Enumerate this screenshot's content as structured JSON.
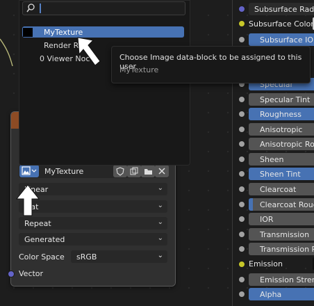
{
  "popup": {
    "search_placeholder": "",
    "items": [
      {
        "label": "MyTexture"
      },
      {
        "label": "Render Re"
      },
      {
        "label": "0 Viewer Noc"
      }
    ]
  },
  "tooltip": {
    "title": "Choose Image data-block to be assigned to this user",
    "value": "MyTexture"
  },
  "node": {
    "image_name": "MyTexture",
    "interpolation": "Linear",
    "projection": "Flat",
    "extension": "Repeat",
    "source": "Generated",
    "color_space_label": "Color Space",
    "color_space_value": "sRGB",
    "output_label": "Vector"
  },
  "bsdf": {
    "rows": [
      {
        "label": "Subsurface Radius"
      },
      {
        "label": "Subsurface Color"
      },
      {
        "label": "Subsurface IOR"
      },
      {
        "label": "Specular"
      },
      {
        "label": "Specular Tint"
      },
      {
        "label": "Roughness"
      },
      {
        "label": "Anisotropic"
      },
      {
        "label": "Anisotropic Rota"
      },
      {
        "label": "Sheen"
      },
      {
        "label": "Sheen Tint"
      },
      {
        "label": "Clearcoat"
      },
      {
        "label": "Clearcoat Rough"
      },
      {
        "label": "IOR"
      },
      {
        "label": "Transmission"
      },
      {
        "label": "Transmission Ro"
      },
      {
        "label": "Emission"
      },
      {
        "label": "Emission Streng"
      },
      {
        "label": "Alpha"
      }
    ]
  },
  "colors": {
    "accent_blue": "#4772b3",
    "node_header": "#8c4b24",
    "socket_gray": "#a1a1a1",
    "socket_yellow": "#c7c729",
    "socket_purple": "#6363c7"
  }
}
